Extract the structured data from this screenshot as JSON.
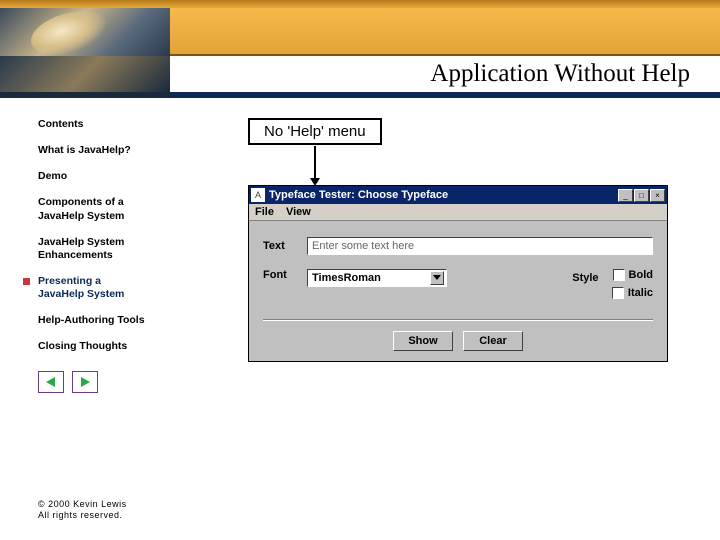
{
  "title": "Application Without Help",
  "sidebar": {
    "items": [
      {
        "label": "Contents"
      },
      {
        "label": "What is JavaHelp?"
      },
      {
        "label": "Demo"
      },
      {
        "label": "Components of a\nJavaHelp System"
      },
      {
        "label": "JavaHelp System\nEnhancements"
      },
      {
        "label": "Presenting a\nJavaHelp System"
      },
      {
        "label": "Help-Authoring Tools"
      },
      {
        "label": "Closing Thoughts"
      }
    ],
    "current_index": 5
  },
  "callout": "No 'Help' menu",
  "app": {
    "titlebar": "Typeface Tester: Choose Typeface",
    "menus": [
      "File",
      "View"
    ],
    "text_label": "Text",
    "text_value": "Enter some text here",
    "font_label": "Font",
    "font_value": "TimesRoman",
    "style_label": "Style",
    "bold_label": "Bold",
    "italic_label": "Italic",
    "show_btn": "Show",
    "clear_btn": "Clear"
  },
  "footer": {
    "line1": "© 2000 Kevin Lewis",
    "line2": "All rights reserved."
  }
}
